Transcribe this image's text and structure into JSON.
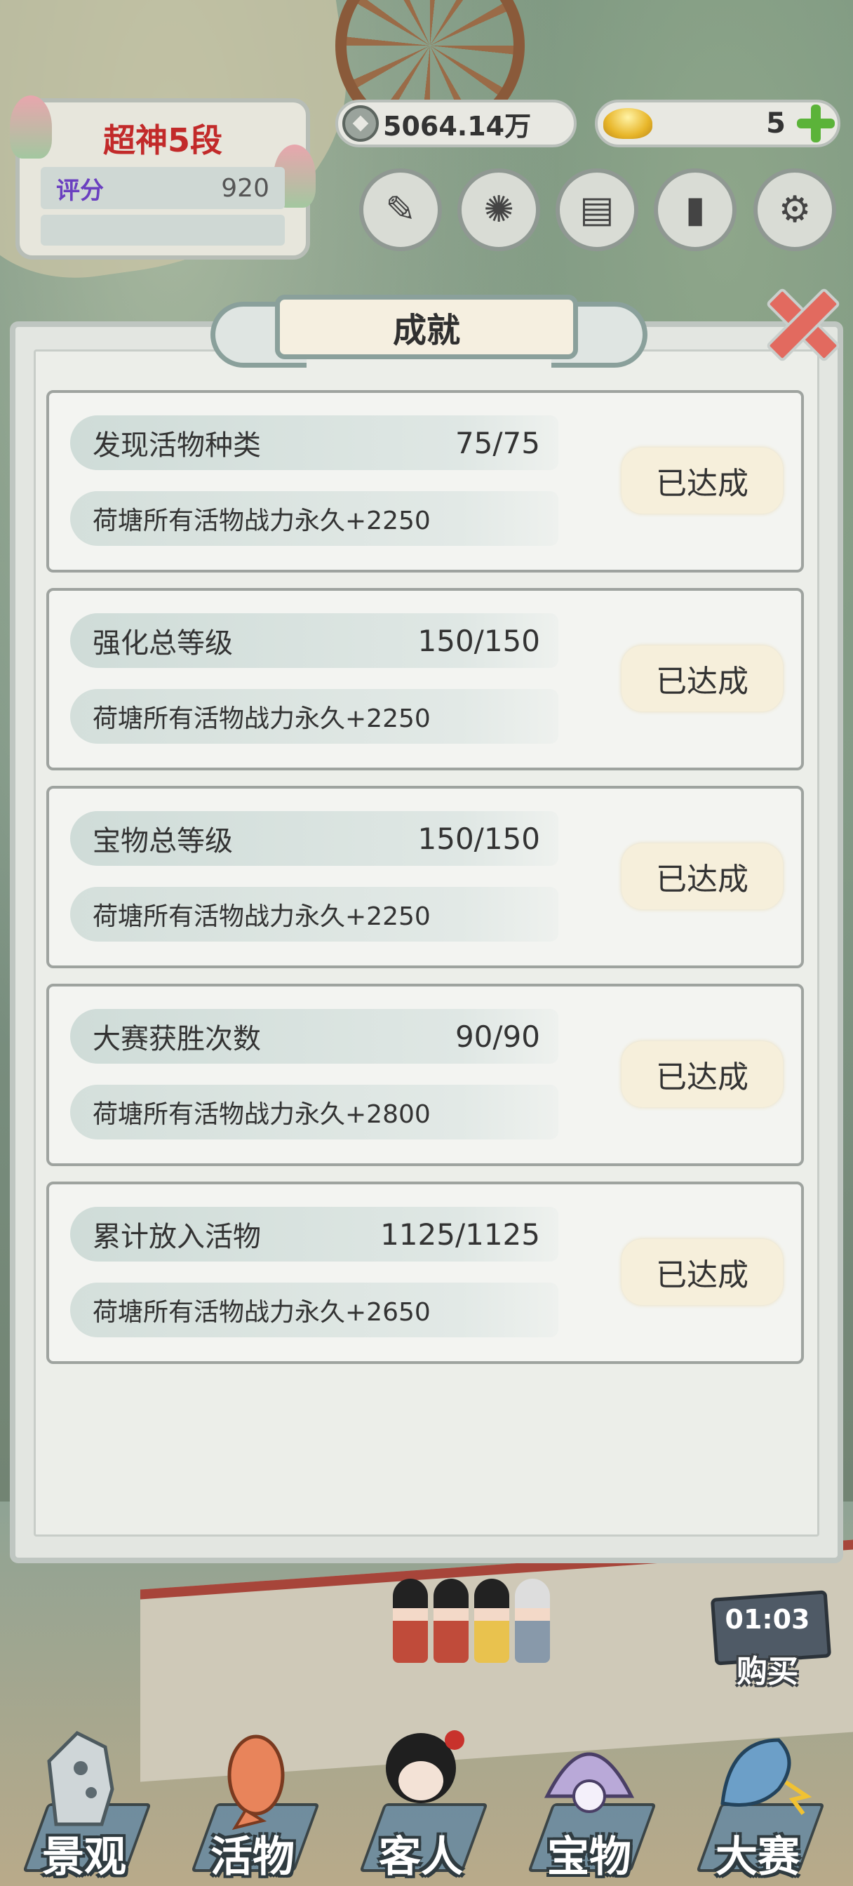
{
  "hud": {
    "rank_title": "超神5段",
    "score_label": "评分",
    "score_value": "920",
    "coins": "5064.14万",
    "gold": "5"
  },
  "modal": {
    "title": "成就",
    "achievements": [
      {
        "name": "发现活物种类",
        "progress": "75/75",
        "reward": "荷塘所有活物战力永久+2250",
        "status": "已达成"
      },
      {
        "name": "强化总等级",
        "progress": "150/150",
        "reward": "荷塘所有活物战力永久+2250",
        "status": "已达成"
      },
      {
        "name": "宝物总等级",
        "progress": "150/150",
        "reward": "荷塘所有活物战力永久+2250",
        "status": "已达成"
      },
      {
        "name": "大赛获胜次数",
        "progress": "90/90",
        "reward": "荷塘所有活物战力永久+2800",
        "status": "已达成"
      },
      {
        "name": "累计放入活物",
        "progress": "1125/1125",
        "reward": "荷塘所有活物战力永久+2650",
        "status": "已达成"
      }
    ]
  },
  "timer": {
    "time": "01:03",
    "buy_label": "购买"
  },
  "nav": {
    "items": [
      {
        "label": "景观",
        "icon": "rock-icon"
      },
      {
        "label": "活物",
        "icon": "koi-fish-icon"
      },
      {
        "label": "客人",
        "icon": "guest-girl-icon"
      },
      {
        "label": "宝物",
        "icon": "pearl-shell-icon"
      },
      {
        "label": "大赛",
        "icon": "dragon-fish-icon"
      }
    ]
  },
  "colors": {
    "rank_red": "#c22a2a",
    "score_purple": "#6a3fc0",
    "plus_green": "#5bb339",
    "close_red": "#e26a5f",
    "status_button_bg": "#f6efdb"
  }
}
